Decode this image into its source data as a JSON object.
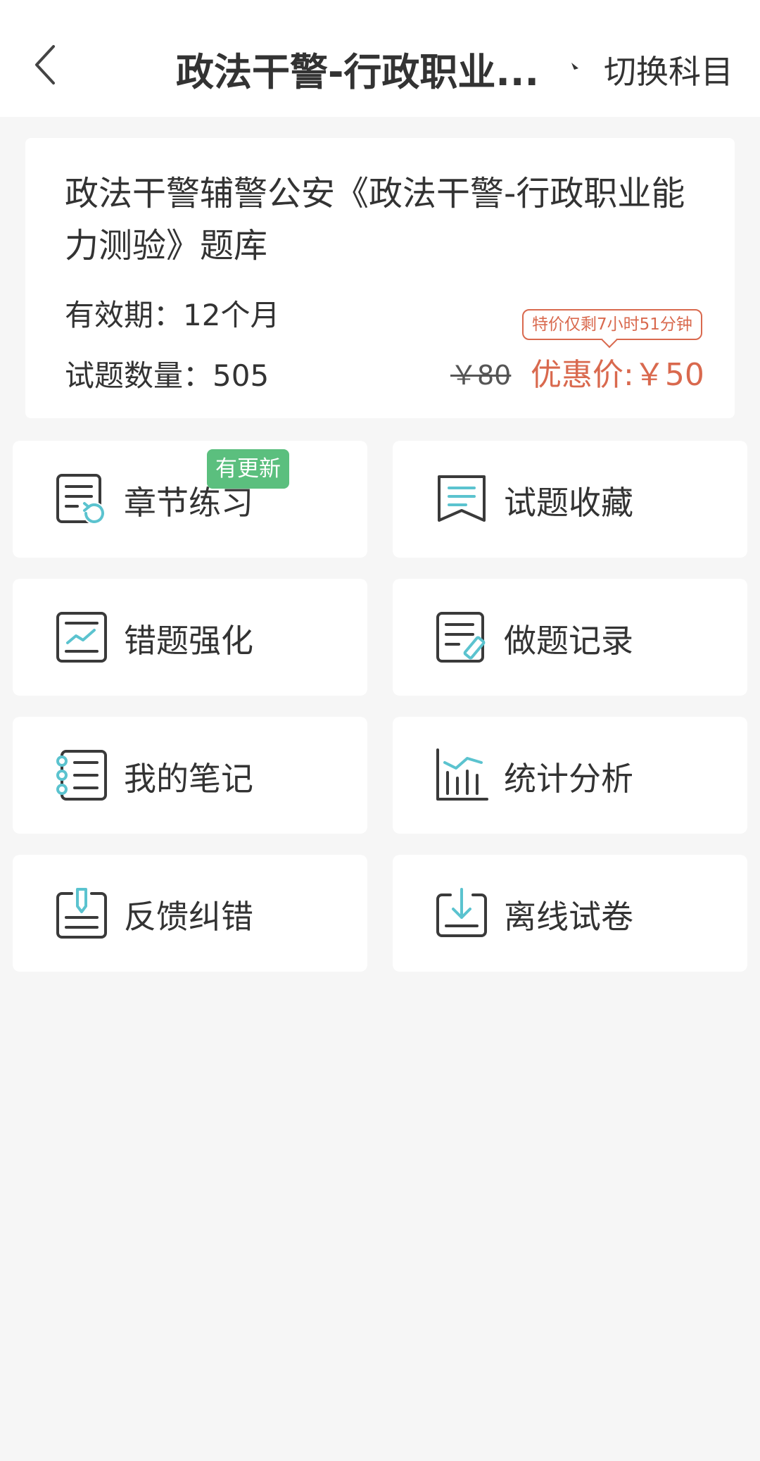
{
  "header": {
    "title": "政法干警-行政职业...",
    "switch_label": "切换科目"
  },
  "product": {
    "name": "政法干警辅警公安《政法干警-行政职业能力测验》题库",
    "validity": "有效期：12个月",
    "count": "试题数量：505",
    "promo": "特价仅剩7小时51分钟",
    "old_price": "￥80",
    "sale_price": "优惠价:￥50"
  },
  "tiles": [
    {
      "label": "章节练习",
      "icon": "chapter-practice-icon",
      "badge": "有更新"
    },
    {
      "label": "试题收藏",
      "icon": "bookmark-icon"
    },
    {
      "label": "错题强化",
      "icon": "wrong-question-chart-icon"
    },
    {
      "label": "做题记录",
      "icon": "record-edit-icon"
    },
    {
      "label": "我的笔记",
      "icon": "notebook-icon"
    },
    {
      "label": "统计分析",
      "icon": "bar-chart-icon"
    },
    {
      "label": "反馈纠错",
      "icon": "feedback-pen-icon"
    },
    {
      "label": "离线试卷",
      "icon": "download-icon"
    }
  ],
  "colors": {
    "accent": "#5bc3cf",
    "price": "#d9694e",
    "badge": "#5bbf7e",
    "icon_dark": "#3a3a3a"
  }
}
